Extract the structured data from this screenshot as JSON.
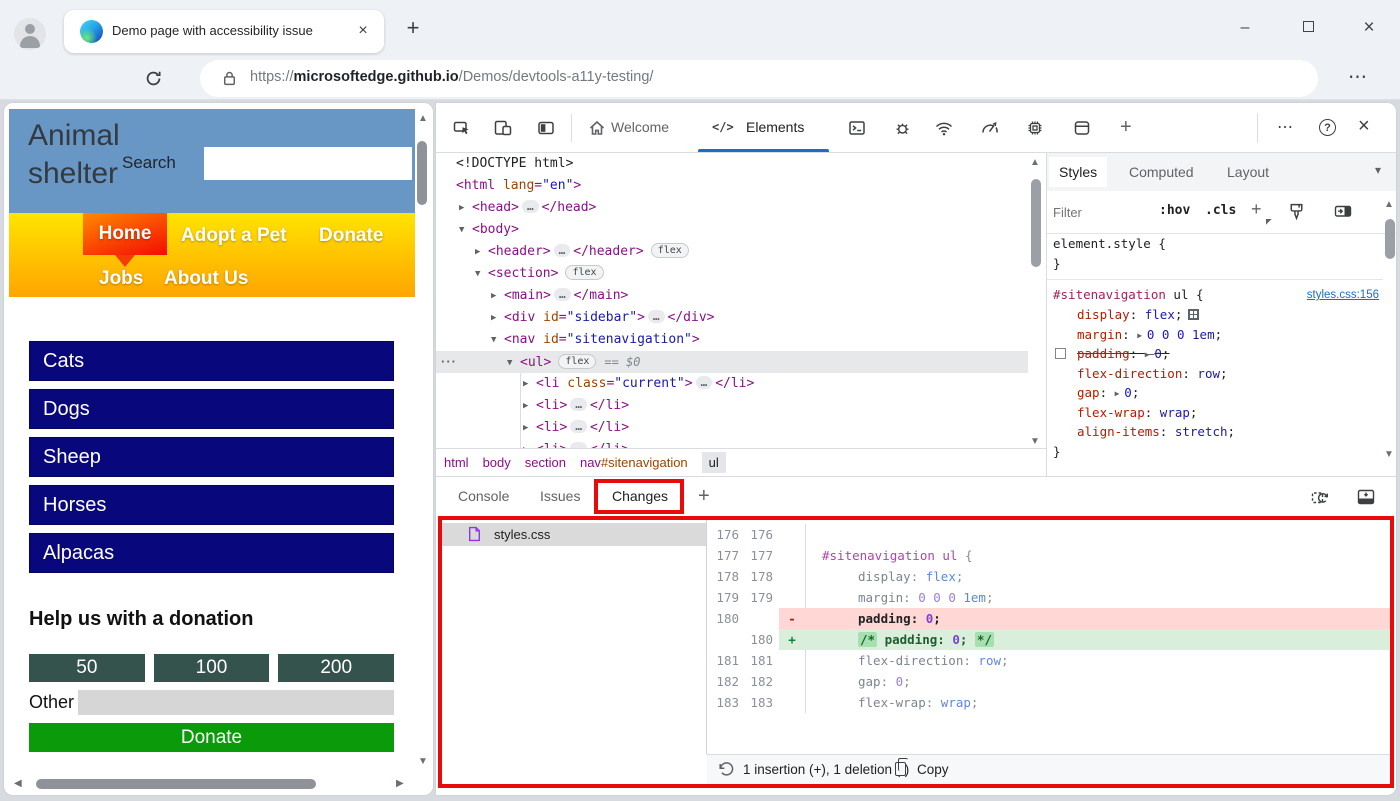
{
  "browser": {
    "tab_title": "Demo page with accessibility issue",
    "url": {
      "protocol": "https://",
      "domain": "microsoftedge.github.io",
      "path": "/Demos/devtools-a11y-testing/"
    }
  },
  "glyphs": {
    "back": "←",
    "forward": "→",
    "more": "⋯",
    "help": "?",
    "close": "×",
    "minimize": "–",
    "plus": "+",
    "elements_icon": "</>",
    "up": "▲",
    "down": "▼",
    "left": "◀",
    "right": "▶",
    "chevron_down": "▾",
    "row_menu": "···"
  },
  "page": {
    "title_line1": "Animal",
    "title_line2": "shelter",
    "search_label": "Search",
    "nav_items": [
      "Home",
      "Adopt a Pet",
      "Donate",
      "Jobs",
      "About Us"
    ],
    "sidebar_links": [
      "Cats",
      "Dogs",
      "Sheep",
      "Horses",
      "Alpacas"
    ],
    "donation_heading": "Help us with a donation",
    "donation_amounts": [
      "50",
      "100",
      "200"
    ],
    "other_label": "Other",
    "donate_label": "Donate"
  },
  "devtools": {
    "toolbar": {
      "welcome": "Welcome",
      "elements": "Elements"
    },
    "dom_tree": [
      {
        "indent": 0,
        "arrow": null,
        "tokens": [
          {
            "c": "doc",
            "v": "<!DOCTYPE html>"
          }
        ]
      },
      {
        "indent": 0,
        "arrow": null,
        "tokens": [
          {
            "c": "tag",
            "v": "<html"
          },
          {
            "c": "attr",
            "v": " lang"
          },
          {
            "c": "tag",
            "v": "="
          },
          {
            "c": "val",
            "v": "\"en\""
          },
          {
            "c": "tag",
            "v": ">"
          }
        ]
      },
      {
        "indent": 1,
        "arrow": "r",
        "tokens": [
          {
            "c": "tag",
            "v": "<head>"
          },
          {
            "c": "ell",
            "v": "…"
          },
          {
            "c": "tag",
            "v": "</head>"
          }
        ]
      },
      {
        "indent": 1,
        "arrow": "d",
        "tokens": [
          {
            "c": "tag",
            "v": "<body>"
          }
        ]
      },
      {
        "indent": 2,
        "arrow": "r",
        "tokens": [
          {
            "c": "tag",
            "v": "<header>"
          },
          {
            "c": "ell",
            "v": "…"
          },
          {
            "c": "tag",
            "v": "</header>"
          },
          {
            "c": "badge",
            "v": "flex"
          }
        ]
      },
      {
        "indent": 2,
        "arrow": "d",
        "tokens": [
          {
            "c": "tag",
            "v": "<section>"
          },
          {
            "c": "badge",
            "v": "flex"
          }
        ]
      },
      {
        "indent": 3,
        "arrow": "r",
        "tokens": [
          {
            "c": "tag",
            "v": "<main>"
          },
          {
            "c": "ell",
            "v": "…"
          },
          {
            "c": "tag",
            "v": "</main>"
          }
        ]
      },
      {
        "indent": 3,
        "arrow": "r",
        "tokens": [
          {
            "c": "tag",
            "v": "<div"
          },
          {
            "c": "attr",
            "v": " id"
          },
          {
            "c": "tag",
            "v": "="
          },
          {
            "c": "val",
            "v": "\"sidebar\""
          },
          {
            "c": "tag",
            "v": ">"
          },
          {
            "c": "ell",
            "v": "…"
          },
          {
            "c": "tag",
            "v": "</div>"
          }
        ]
      },
      {
        "indent": 3,
        "arrow": "d",
        "tokens": [
          {
            "c": "tag",
            "v": "<nav"
          },
          {
            "c": "attr",
            "v": " id"
          },
          {
            "c": "tag",
            "v": "="
          },
          {
            "c": "val",
            "v": "\"sitenavigation\""
          },
          {
            "c": "tag",
            "v": ">"
          }
        ]
      },
      {
        "indent": 4,
        "arrow": "d",
        "selected": true,
        "dots": true,
        "tokens": [
          {
            "c": "tag",
            "v": "<ul>"
          },
          {
            "c": "badge",
            "v": "flex"
          },
          {
            "c": "eq",
            "v": "== $0"
          }
        ]
      },
      {
        "indent": 5,
        "arrow": "r",
        "tokens": [
          {
            "c": "tag",
            "v": "<li"
          },
          {
            "c": "attr",
            "v": " class"
          },
          {
            "c": "tag",
            "v": "="
          },
          {
            "c": "val",
            "v": "\"current\""
          },
          {
            "c": "tag",
            "v": ">"
          },
          {
            "c": "ell",
            "v": "…"
          },
          {
            "c": "tag",
            "v": "</li>"
          }
        ]
      },
      {
        "indent": 5,
        "arrow": "r",
        "tokens": [
          {
            "c": "tag",
            "v": "<li>"
          },
          {
            "c": "ell",
            "v": "…"
          },
          {
            "c": "tag",
            "v": "</li>"
          }
        ]
      },
      {
        "indent": 5,
        "arrow": "r",
        "tokens": [
          {
            "c": "tag",
            "v": "<li>"
          },
          {
            "c": "ell",
            "v": "…"
          },
          {
            "c": "tag",
            "v": "</li>"
          }
        ]
      },
      {
        "indent": 5,
        "arrow": "r",
        "tokens": [
          {
            "c": "tag",
            "v": "<li>"
          },
          {
            "c": "ell",
            "v": "…"
          },
          {
            "c": "tag",
            "v": "</li>"
          }
        ]
      }
    ],
    "breadcrumb": [
      {
        "label": "html"
      },
      {
        "label": "body"
      },
      {
        "label": "section"
      },
      {
        "label": "nav",
        "id": "#sitenavigation"
      },
      {
        "label": "ul",
        "active": true
      }
    ],
    "styles": {
      "tabs": [
        "Styles",
        "Computed",
        "Layout"
      ],
      "filter_placeholder": "Filter",
      "pseudo_button": ":hov",
      "class_button": ".cls",
      "element_style_open": "element.style {",
      "element_style_close": "}",
      "rule": {
        "selector_id": "#sitenavigation",
        "selector_rest": " ul {",
        "source": "styles.css:156",
        "close": "}",
        "properties": [
          {
            "name": "display",
            "value": "flex",
            "flexicon": true
          },
          {
            "name": "margin",
            "value": "0 0 0 1em",
            "arrow": true
          },
          {
            "name": "padding",
            "value": "0",
            "arrow": true,
            "struck": true,
            "checkbox": true
          },
          {
            "name": "flex-direction",
            "value": "row"
          },
          {
            "name": "gap",
            "value": "0",
            "arrow": true
          },
          {
            "name": "flex-wrap",
            "value": "wrap"
          },
          {
            "name": "align-items",
            "value": "stretch"
          }
        ]
      }
    },
    "drawer_tabs": [
      "Console",
      "Issues",
      "Changes"
    ],
    "changes": {
      "file": "styles.css",
      "diff": [
        {
          "old": "176",
          "new": "176",
          "marker": "",
          "kind": "ctx",
          "ind": 0,
          "tokens": []
        },
        {
          "old": "177",
          "new": "177",
          "marker": "",
          "kind": "ctx",
          "ind": 0,
          "tokens": [
            {
              "c": "dsel",
              "v": "#sitenavigation ul"
            },
            {
              "c": "dpln",
              "v": " {"
            }
          ]
        },
        {
          "old": "178",
          "new": "178",
          "marker": "",
          "kind": "ctx",
          "ind": 1,
          "tokens": [
            {
              "c": "dprop",
              "v": "display"
            },
            {
              "c": "dpln",
              "v": ": "
            },
            {
              "c": "dval",
              "v": "flex"
            },
            {
              "c": "dpln",
              "v": ";"
            }
          ]
        },
        {
          "old": "179",
          "new": "179",
          "marker": "",
          "kind": "ctx",
          "ind": 1,
          "tokens": [
            {
              "c": "dprop",
              "v": "margin"
            },
            {
              "c": "dpln",
              "v": ": "
            },
            {
              "c": "dnum",
              "v": "0 0 0"
            },
            {
              "c": "dval",
              "v": " 1em"
            },
            {
              "c": "dpln",
              "v": ";"
            }
          ]
        },
        {
          "old": "180",
          "new": "",
          "marker": "-",
          "kind": "del",
          "ind": 1,
          "tokens": [
            {
              "c": "dstrong",
              "v": "padding"
            },
            {
              "c": "dstrong",
              "v": ": "
            },
            {
              "c": "dnum2",
              "v": "0"
            },
            {
              "c": "dstrong",
              "v": ";"
            }
          ]
        },
        {
          "old": "",
          "new": "180",
          "marker": "+",
          "kind": "add",
          "ind": 1,
          "tokens": [
            {
              "c": "dcmthl",
              "v": "/*"
            },
            {
              "c": "dadd",
              "v": " padding: "
            },
            {
              "c": "dnum2",
              "v": "0"
            },
            {
              "c": "dadd",
              "v": "; "
            },
            {
              "c": "dcmthl",
              "v": "*/"
            }
          ]
        },
        {
          "old": "181",
          "new": "181",
          "marker": "",
          "kind": "ctx",
          "ind": 1,
          "tokens": [
            {
              "c": "dprop",
              "v": "flex-direction"
            },
            {
              "c": "dpln",
              "v": ": "
            },
            {
              "c": "dval",
              "v": "row"
            },
            {
              "c": "dpln",
              "v": ";"
            }
          ]
        },
        {
          "old": "182",
          "new": "182",
          "marker": "",
          "kind": "ctx",
          "ind": 1,
          "tokens": [
            {
              "c": "dprop",
              "v": "gap"
            },
            {
              "c": "dpln",
              "v": ": "
            },
            {
              "c": "dnum",
              "v": "0"
            },
            {
              "c": "dpln",
              "v": ";"
            }
          ]
        },
        {
          "old": "183",
          "new": "183",
          "marker": "",
          "kind": "ctx",
          "ind": 1,
          "tokens": [
            {
              "c": "dprop",
              "v": "flex-wrap"
            },
            {
              "c": "dpln",
              "v": ": "
            },
            {
              "c": "dval",
              "v": "wrap"
            },
            {
              "c": "dpln",
              "v": ";"
            }
          ]
        }
      ],
      "status": "1 insertion (+), 1 deletion (-)",
      "copy_label": "Copy"
    }
  },
  "colors": {
    "accent_blue": "#1b6ec2",
    "annotation_red": "#e80b0b",
    "header_blue": "#6897c6",
    "nav_yellow": "#ffe400",
    "nav_orange": "#ffa500",
    "link_navy": "#08087c",
    "amount_slate": "#35534d",
    "donate_green": "#0a9a0a",
    "diff_del_bg": "#ffd7d5",
    "diff_add_bg": "#d9efdc"
  }
}
